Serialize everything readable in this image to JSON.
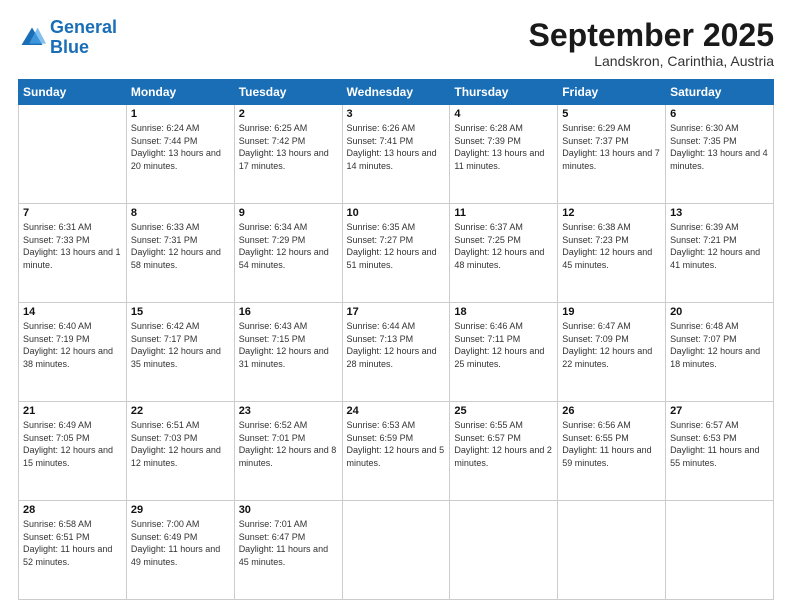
{
  "header": {
    "logo_general": "General",
    "logo_blue": "Blue",
    "month": "September 2025",
    "location": "Landskron, Carinthia, Austria"
  },
  "weekdays": [
    "Sunday",
    "Monday",
    "Tuesday",
    "Wednesday",
    "Thursday",
    "Friday",
    "Saturday"
  ],
  "weeks": [
    [
      {
        "day": "",
        "sunrise": "",
        "sunset": "",
        "daylight": ""
      },
      {
        "day": "1",
        "sunrise": "Sunrise: 6:24 AM",
        "sunset": "Sunset: 7:44 PM",
        "daylight": "Daylight: 13 hours and 20 minutes."
      },
      {
        "day": "2",
        "sunrise": "Sunrise: 6:25 AM",
        "sunset": "Sunset: 7:42 PM",
        "daylight": "Daylight: 13 hours and 17 minutes."
      },
      {
        "day": "3",
        "sunrise": "Sunrise: 6:26 AM",
        "sunset": "Sunset: 7:41 PM",
        "daylight": "Daylight: 13 hours and 14 minutes."
      },
      {
        "day": "4",
        "sunrise": "Sunrise: 6:28 AM",
        "sunset": "Sunset: 7:39 PM",
        "daylight": "Daylight: 13 hours and 11 minutes."
      },
      {
        "day": "5",
        "sunrise": "Sunrise: 6:29 AM",
        "sunset": "Sunset: 7:37 PM",
        "daylight": "Daylight: 13 hours and 7 minutes."
      },
      {
        "day": "6",
        "sunrise": "Sunrise: 6:30 AM",
        "sunset": "Sunset: 7:35 PM",
        "daylight": "Daylight: 13 hours and 4 minutes."
      }
    ],
    [
      {
        "day": "7",
        "sunrise": "Sunrise: 6:31 AM",
        "sunset": "Sunset: 7:33 PM",
        "daylight": "Daylight: 13 hours and 1 minute."
      },
      {
        "day": "8",
        "sunrise": "Sunrise: 6:33 AM",
        "sunset": "Sunset: 7:31 PM",
        "daylight": "Daylight: 12 hours and 58 minutes."
      },
      {
        "day": "9",
        "sunrise": "Sunrise: 6:34 AM",
        "sunset": "Sunset: 7:29 PM",
        "daylight": "Daylight: 12 hours and 54 minutes."
      },
      {
        "day": "10",
        "sunrise": "Sunrise: 6:35 AM",
        "sunset": "Sunset: 7:27 PM",
        "daylight": "Daylight: 12 hours and 51 minutes."
      },
      {
        "day": "11",
        "sunrise": "Sunrise: 6:37 AM",
        "sunset": "Sunset: 7:25 PM",
        "daylight": "Daylight: 12 hours and 48 minutes."
      },
      {
        "day": "12",
        "sunrise": "Sunrise: 6:38 AM",
        "sunset": "Sunset: 7:23 PM",
        "daylight": "Daylight: 12 hours and 45 minutes."
      },
      {
        "day": "13",
        "sunrise": "Sunrise: 6:39 AM",
        "sunset": "Sunset: 7:21 PM",
        "daylight": "Daylight: 12 hours and 41 minutes."
      }
    ],
    [
      {
        "day": "14",
        "sunrise": "Sunrise: 6:40 AM",
        "sunset": "Sunset: 7:19 PM",
        "daylight": "Daylight: 12 hours and 38 minutes."
      },
      {
        "day": "15",
        "sunrise": "Sunrise: 6:42 AM",
        "sunset": "Sunset: 7:17 PM",
        "daylight": "Daylight: 12 hours and 35 minutes."
      },
      {
        "day": "16",
        "sunrise": "Sunrise: 6:43 AM",
        "sunset": "Sunset: 7:15 PM",
        "daylight": "Daylight: 12 hours and 31 minutes."
      },
      {
        "day": "17",
        "sunrise": "Sunrise: 6:44 AM",
        "sunset": "Sunset: 7:13 PM",
        "daylight": "Daylight: 12 hours and 28 minutes."
      },
      {
        "day": "18",
        "sunrise": "Sunrise: 6:46 AM",
        "sunset": "Sunset: 7:11 PM",
        "daylight": "Daylight: 12 hours and 25 minutes."
      },
      {
        "day": "19",
        "sunrise": "Sunrise: 6:47 AM",
        "sunset": "Sunset: 7:09 PM",
        "daylight": "Daylight: 12 hours and 22 minutes."
      },
      {
        "day": "20",
        "sunrise": "Sunrise: 6:48 AM",
        "sunset": "Sunset: 7:07 PM",
        "daylight": "Daylight: 12 hours and 18 minutes."
      }
    ],
    [
      {
        "day": "21",
        "sunrise": "Sunrise: 6:49 AM",
        "sunset": "Sunset: 7:05 PM",
        "daylight": "Daylight: 12 hours and 15 minutes."
      },
      {
        "day": "22",
        "sunrise": "Sunrise: 6:51 AM",
        "sunset": "Sunset: 7:03 PM",
        "daylight": "Daylight: 12 hours and 12 minutes."
      },
      {
        "day": "23",
        "sunrise": "Sunrise: 6:52 AM",
        "sunset": "Sunset: 7:01 PM",
        "daylight": "Daylight: 12 hours and 8 minutes."
      },
      {
        "day": "24",
        "sunrise": "Sunrise: 6:53 AM",
        "sunset": "Sunset: 6:59 PM",
        "daylight": "Daylight: 12 hours and 5 minutes."
      },
      {
        "day": "25",
        "sunrise": "Sunrise: 6:55 AM",
        "sunset": "Sunset: 6:57 PM",
        "daylight": "Daylight: 12 hours and 2 minutes."
      },
      {
        "day": "26",
        "sunrise": "Sunrise: 6:56 AM",
        "sunset": "Sunset: 6:55 PM",
        "daylight": "Daylight: 11 hours and 59 minutes."
      },
      {
        "day": "27",
        "sunrise": "Sunrise: 6:57 AM",
        "sunset": "Sunset: 6:53 PM",
        "daylight": "Daylight: 11 hours and 55 minutes."
      }
    ],
    [
      {
        "day": "28",
        "sunrise": "Sunrise: 6:58 AM",
        "sunset": "Sunset: 6:51 PM",
        "daylight": "Daylight: 11 hours and 52 minutes."
      },
      {
        "day": "29",
        "sunrise": "Sunrise: 7:00 AM",
        "sunset": "Sunset: 6:49 PM",
        "daylight": "Daylight: 11 hours and 49 minutes."
      },
      {
        "day": "30",
        "sunrise": "Sunrise: 7:01 AM",
        "sunset": "Sunset: 6:47 PM",
        "daylight": "Daylight: 11 hours and 45 minutes."
      },
      {
        "day": "",
        "sunrise": "",
        "sunset": "",
        "daylight": ""
      },
      {
        "day": "",
        "sunrise": "",
        "sunset": "",
        "daylight": ""
      },
      {
        "day": "",
        "sunrise": "",
        "sunset": "",
        "daylight": ""
      },
      {
        "day": "",
        "sunrise": "",
        "sunset": "",
        "daylight": ""
      }
    ]
  ]
}
